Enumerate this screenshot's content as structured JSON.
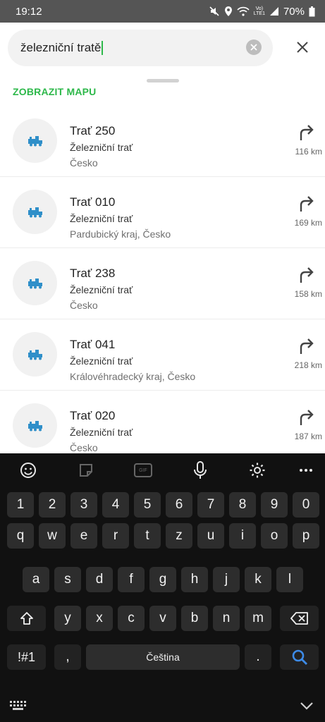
{
  "status_bar": {
    "time": "19:12",
    "battery": "70%",
    "network_top": "Vo)",
    "network_bottom": "LTE1"
  },
  "search": {
    "query": "železniční tratě"
  },
  "show_map_label": "ZOBRAZIT MAPU",
  "results": [
    {
      "title": "Trať 250",
      "type": "Železniční trať",
      "region": "Česko",
      "distance": "116 km"
    },
    {
      "title": "Trať 010",
      "type": "Železniční trať",
      "region": "Pardubický kraj, Česko",
      "distance": "169 km"
    },
    {
      "title": "Trať 238",
      "type": "Železniční trať",
      "region": "Česko",
      "distance": "158 km"
    },
    {
      "title": "Trať 041",
      "type": "Železniční trať",
      "region": "Královéhradecký kraj, Česko",
      "distance": "218 km"
    },
    {
      "title": "Trať 020",
      "type": "Železniční trať",
      "region": "Česko",
      "distance": "187 km"
    }
  ],
  "keyboard": {
    "toolbar": {
      "gif": "GIF"
    },
    "row_numbers": [
      "1",
      "2",
      "3",
      "4",
      "5",
      "6",
      "7",
      "8",
      "9",
      "0"
    ],
    "row_top": [
      "q",
      "w",
      "e",
      "r",
      "t",
      "z",
      "u",
      "i",
      "o",
      "p"
    ],
    "row_middle": [
      "a",
      "s",
      "d",
      "f",
      "g",
      "h",
      "j",
      "k",
      "l"
    ],
    "row_bottom": [
      "y",
      "x",
      "c",
      "v",
      "b",
      "n",
      "m"
    ],
    "symbols_label": "!#1",
    "comma_label": ",",
    "space_label": "Čeština",
    "period_label": "."
  },
  "colors": {
    "accent": "#2db84a",
    "train_icon": "#2f8fc9",
    "search_key": "#3d8be8"
  }
}
